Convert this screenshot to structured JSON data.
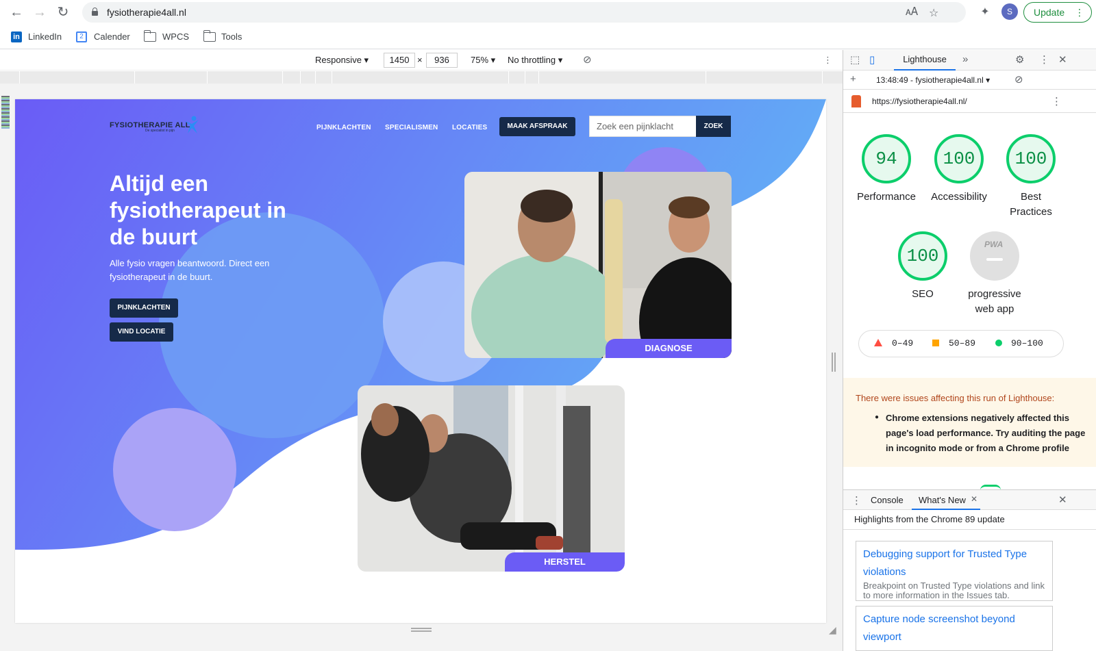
{
  "browser": {
    "url": "fysiotherapie4all.nl",
    "profile_initial": "S",
    "update_label": "Update",
    "bookmarks": [
      {
        "label": "LinkedIn",
        "icon": "linkedin-icon"
      },
      {
        "label": "Calender",
        "icon": "calendar-icon"
      },
      {
        "label": "WPCS",
        "icon": "folder-icon"
      },
      {
        "label": "Tools",
        "icon": "folder-icon"
      }
    ]
  },
  "device_toolbar": {
    "mode": "Responsive ▾",
    "width": "1450",
    "height": "936",
    "zoom": "75% ▾",
    "throttling": "No throttling ▾"
  },
  "site": {
    "logo_text": "FYSIOTHERAPIE  ALL",
    "logo_sub": "De specialist in pijn",
    "nav": [
      "PIJNKLACHTEN",
      "SPECIALISMEN",
      "LOCATIES"
    ],
    "cta": "MAAK AFSPRAAK",
    "search_placeholder": "Zoek een pijnklacht",
    "search_button": "ZOEK",
    "hero_title": "Altijd een fysiotherapeut in de buurt",
    "hero_sub": "Alle fysio vragen beantwoord. Direct een fysiotherapeut in de buurt.",
    "btn_pijn": "PIJNKLACHTEN",
    "btn_locatie": "VIND LOCATIE",
    "card1_label": "DIAGNOSE",
    "card2_label": "HERSTEL",
    "colors": {
      "gradient_start": "#6a5cf6",
      "gradient_end": "#63b3f5",
      "navy": "#162a49",
      "label": "#6b5cf5"
    }
  },
  "devtools": {
    "active_tab": "Lighthouse",
    "report": "13:48:49 - fysiotherapie4all.nl ▾",
    "report_url": "https://fysiotherapie4all.nl/",
    "scores": [
      {
        "label": "Performance",
        "value": "94"
      },
      {
        "label": "Accessibility",
        "value": "100"
      },
      {
        "label": "Best Practices",
        "value": "100"
      },
      {
        "label": "SEO",
        "value": "100"
      }
    ],
    "pwa_label": "progressive web app",
    "pwa_badge": "PWA",
    "legend": [
      "0–49",
      "50–89",
      "90–100"
    ],
    "warning_title": "There were issues affecting this run of Lighthouse:",
    "warning_item": "Chrome extensions negatively affected this page's load performance. Try auditing the page in incognito mode or from a Chrome profile without extensions.",
    "drawer_tabs": [
      "Console",
      "What's New"
    ],
    "whatsnew_head": "Highlights from the Chrome 89 update",
    "cards": [
      {
        "title": "Debugging support for Trusted Type violations",
        "desc": "Breakpoint on Trusted Type violations and link to more information in the Issues tab."
      },
      {
        "title": "Capture node screenshot beyond viewport",
        "desc": ""
      }
    ]
  }
}
